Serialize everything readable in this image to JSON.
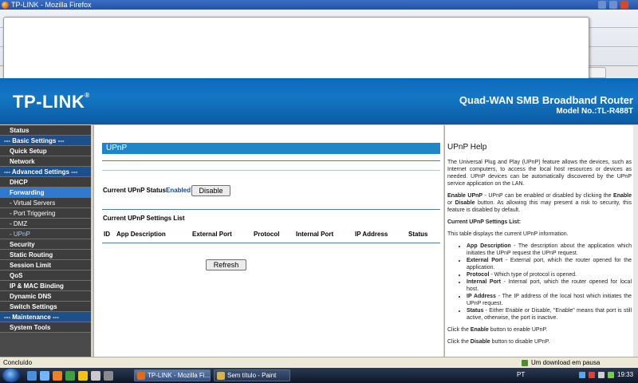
{
  "browser": {
    "window_title": "TP-LINK - Mozilla Firefox",
    "colors": {
      "title_bar": "#2352a8"
    }
  },
  "header": {
    "logo": "TP-LINK",
    "product_name": "Quad-WAN SMB Broadband Router",
    "model": "Model No.:TL-R488T",
    "colors": {
      "background": "#0d69b8",
      "text": "#ffffff"
    }
  },
  "sidebar": {
    "items": [
      {
        "label": "Status",
        "type": "item"
      },
      {
        "label": "--- Basic Settings ---",
        "type": "section"
      },
      {
        "label": "Quick Setup",
        "type": "item"
      },
      {
        "label": "Network",
        "type": "item"
      },
      {
        "label": "--- Advanced Settings ---",
        "type": "section"
      },
      {
        "label": "DHCP",
        "type": "item"
      },
      {
        "label": "Forwarding",
        "type": "selected"
      },
      {
        "label": "- Virtual Servers",
        "type": "sub"
      },
      {
        "label": "- Port Triggering",
        "type": "sub"
      },
      {
        "label": "- DMZ",
        "type": "sub"
      },
      {
        "label": "- UPnP",
        "type": "subsel"
      },
      {
        "label": "Security",
        "type": "item"
      },
      {
        "label": "Static Routing",
        "type": "item"
      },
      {
        "label": "Session Limit",
        "type": "item"
      },
      {
        "label": "QoS",
        "type": "item"
      },
      {
        "label": "IP & MAC Binding",
        "type": "item"
      },
      {
        "label": "Dynamic DNS",
        "type": "item"
      },
      {
        "label": "Switch Settings",
        "type": "item"
      },
      {
        "label": "--- Maintenance ---",
        "type": "section"
      },
      {
        "label": "System Tools",
        "type": "item"
      }
    ],
    "colors": {
      "item_bg": "#3d3d3d",
      "section_bg": "#1d4f88",
      "selected_bg": "#2c7bd1"
    }
  },
  "main": {
    "title": "UPnP",
    "status_label": "Current UPnP Status:",
    "status_value": "Enabled",
    "disable_button": "Disable",
    "list_title": "Current UPnP Settings List",
    "columns": [
      "ID",
      "App Description",
      "External Port",
      "Protocol",
      "Internal Port",
      "IP Address",
      "Status"
    ],
    "refresh_button": "Refresh",
    "colors": {
      "title_bar": "#1f86c9"
    }
  },
  "help": {
    "title": "UPnP Help",
    "intro": "The Universal Plug and Play (UPnP) feature allows the devices, such as Internet computers, to access the local host resources or devices as needed. UPnP devices can be automatically discovered by the UPnP service application on the LAN.",
    "enable_term": "Enable UPnP",
    "enable_text1": " - UPnP can be enabled or disabled by clicking the ",
    "enable_word": "Enable",
    "enable_or": " or ",
    "disable_word": "Disable",
    "enable_text2": " button. As allowing this may present a risk to security, this feature is disabled by default.",
    "list_heading": "Current UPnP Settings List:",
    "list_intro": "This table displays the current UPnP information.",
    "defs": [
      {
        "term": "App Description",
        "text": " - The description about the application which initiates the UPnP request the UPnP request."
      },
      {
        "term": "External Port",
        "text": " - External port, which the router opened for the application."
      },
      {
        "term": "Protocol",
        "text": " - Which type of protocol is opened."
      },
      {
        "term": "Internal Port",
        "text": " - Internal port, which the router opened for local host."
      },
      {
        "term": "IP Address",
        "text": " - The IP address of the local host which initiates the UPnP request."
      },
      {
        "term": "Status",
        "text": " - Either Enable or Disable, \"Enable\" means that port is still active, otherwise, the port is inactive."
      }
    ],
    "click_enable_a": "Click the ",
    "click_enable_b": "Enable",
    "click_enable_c": " button to enable UPnP.",
    "click_disable_a": "Click the ",
    "click_disable_b": "Disable",
    "click_disable_c": " button to disable UPnP."
  },
  "statusbar": {
    "left": "Concluído",
    "download": "Um download em pausa"
  },
  "taskbar": {
    "tasks": [
      {
        "label": "TP-LINK - Mozilla Fi...",
        "active": true
      },
      {
        "label": "Sem título - Paint",
        "active": false
      }
    ],
    "language": "PT",
    "clock": "19:33"
  }
}
